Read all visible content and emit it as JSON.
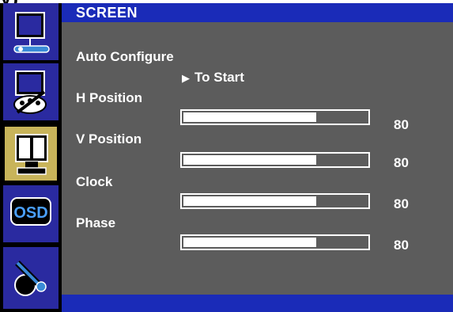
{
  "header": {
    "title": "SCREEN"
  },
  "sidebar": {
    "items": [
      {
        "name": "picture-menu"
      },
      {
        "name": "color-menu"
      },
      {
        "name": "screen-menu",
        "active": true
      },
      {
        "name": "osd-menu",
        "label": "OSD"
      },
      {
        "name": "setup-menu"
      }
    ]
  },
  "menu": {
    "auto_configure": {
      "label": "Auto Configure",
      "action": "To Start"
    },
    "items": [
      {
        "label": "H Position",
        "value": "80",
        "level_percent": 72
      },
      {
        "label": "V Position",
        "value": "80",
        "level_percent": 72
      },
      {
        "label": "Clock",
        "value": "80",
        "level_percent": 72
      },
      {
        "label": "Phase",
        "value": "80",
        "level_percent": 72
      }
    ]
  },
  "colors": {
    "header": "#1a2bb8",
    "panel": "#5c5c5c",
    "active_tile": "#c8b45a",
    "tile": "#2a2aa0"
  }
}
